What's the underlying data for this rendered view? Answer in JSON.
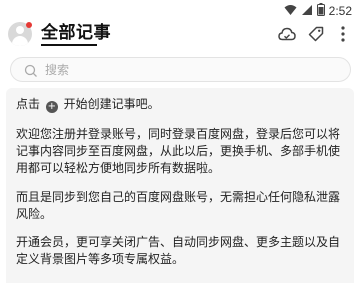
{
  "status_bar": {
    "time": "2:52"
  },
  "header": {
    "title": "全部记事"
  },
  "search": {
    "placeholder": "搜索"
  },
  "content": {
    "tip_before": "点击",
    "tip_after": "开始创建记事吧。",
    "paragraphs": [
      "欢迎您注册并登录账号，同时登录百度网盘，登录后您可以将记事内容同步至百度网盘，从此以后，更换手机、多部手机使用都可以轻松方便地同步所有数据啦。",
      "而且是同步到您自己的百度网盘账号，无需担心任何隐私泄露风险。",
      "开通会员，更可享关闭广告、自动同步网盘、更多主题以及自定义背景图片等多项专属权益。"
    ]
  }
}
